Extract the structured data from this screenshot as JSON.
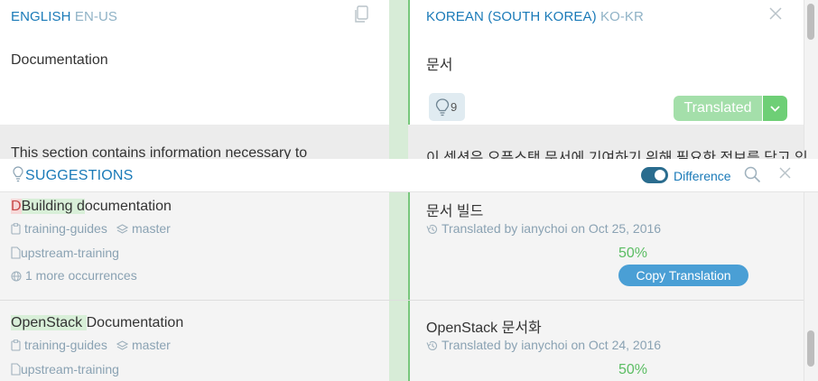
{
  "source": {
    "lang_name": "ENGLISH",
    "lang_code": "EN-US",
    "text": "Documentation"
  },
  "target": {
    "lang_name": "KOREAN (SOUTH KOREA)",
    "lang_code": "KO-KR",
    "text": "문서",
    "suggestion_count": "9",
    "status_label": "Translated"
  },
  "next_row": {
    "source_text": "This section contains information necessary to",
    "target_text": "이 섹션은 오픈스택 문서에 기여하기 위해 필요한 정보를 담고 있"
  },
  "suggestions_panel": {
    "title": "SUGGESTIONS",
    "difference_label": "Difference",
    "difference_enabled": true
  },
  "suggestions": [
    {
      "source_parts": [
        "D",
        "Building d",
        "ocumentation"
      ],
      "project": "training-guides",
      "version": "master",
      "document": "upstream-training",
      "occurrences": "1 more occurrences",
      "translation": "문서 빌드",
      "translated_by": "Translated by ianychoi on Oct 25, 2016",
      "match_percent": "50%",
      "copy_label": "Copy Translation"
    },
    {
      "source_parts": [
        "OpenStack ",
        "Documentation"
      ],
      "project": "training-guides",
      "version": "master",
      "document": "upstream-training",
      "translation": "OpenStack 문서화",
      "translated_by": "Translated by ianychoi on Oct 24, 2016",
      "match_percent": "50%"
    }
  ],
  "colors": {
    "accent": "#1a7ab8",
    "translated": "#6ecf76",
    "match": "#5bbd63",
    "copy_button": "#4a9fd5"
  },
  "icons": [
    "copy-icon",
    "close-icon",
    "lightbulb-icon",
    "chevron-down-icon",
    "search-icon",
    "clipboard-icon",
    "layers-icon",
    "document-icon",
    "globe-icon",
    "history-icon"
  ]
}
